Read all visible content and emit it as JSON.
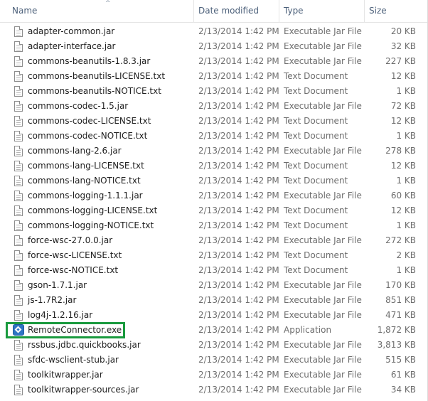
{
  "columns": {
    "name": "Name",
    "date": "Date modified",
    "type": "Type",
    "size": "Size"
  },
  "colors": {
    "highlight": "#1a9a3e",
    "header_text": "#4c607a",
    "app_icon": "#2f75c4"
  },
  "files": [
    {
      "name": "adapter-common.jar",
      "date": "2/13/2014 1:42 PM",
      "type": "Executable Jar File",
      "size": "20 KB",
      "icon": "file-icon"
    },
    {
      "name": "adapter-interface.jar",
      "date": "2/13/2014 1:42 PM",
      "type": "Executable Jar File",
      "size": "32 KB",
      "icon": "file-icon"
    },
    {
      "name": "commons-beanutils-1.8.3.jar",
      "date": "2/13/2014 1:42 PM",
      "type": "Executable Jar File",
      "size": "227 KB",
      "icon": "file-icon"
    },
    {
      "name": "commons-beanutils-LICENSE.txt",
      "date": "2/13/2014 1:42 PM",
      "type": "Text Document",
      "size": "12 KB",
      "icon": "file-icon"
    },
    {
      "name": "commons-beanutils-NOTICE.txt",
      "date": "2/13/2014 1:42 PM",
      "type": "Text Document",
      "size": "1 KB",
      "icon": "file-icon"
    },
    {
      "name": "commons-codec-1.5.jar",
      "date": "2/13/2014 1:42 PM",
      "type": "Executable Jar File",
      "size": "72 KB",
      "icon": "file-icon"
    },
    {
      "name": "commons-codec-LICENSE.txt",
      "date": "2/13/2014 1:42 PM",
      "type": "Text Document",
      "size": "12 KB",
      "icon": "file-icon"
    },
    {
      "name": "commons-codec-NOTICE.txt",
      "date": "2/13/2014 1:42 PM",
      "type": "Text Document",
      "size": "1 KB",
      "icon": "file-icon"
    },
    {
      "name": "commons-lang-2.6.jar",
      "date": "2/13/2014 1:42 PM",
      "type": "Executable Jar File",
      "size": "278 KB",
      "icon": "file-icon"
    },
    {
      "name": "commons-lang-LICENSE.txt",
      "date": "2/13/2014 1:42 PM",
      "type": "Text Document",
      "size": "12 KB",
      "icon": "file-icon"
    },
    {
      "name": "commons-lang-NOTICE.txt",
      "date": "2/13/2014 1:42 PM",
      "type": "Text Document",
      "size": "1 KB",
      "icon": "file-icon"
    },
    {
      "name": "commons-logging-1.1.1.jar",
      "date": "2/13/2014 1:42 PM",
      "type": "Executable Jar File",
      "size": "60 KB",
      "icon": "file-icon"
    },
    {
      "name": "commons-logging-LICENSE.txt",
      "date": "2/13/2014 1:42 PM",
      "type": "Text Document",
      "size": "12 KB",
      "icon": "file-icon"
    },
    {
      "name": "commons-logging-NOTICE.txt",
      "date": "2/13/2014 1:42 PM",
      "type": "Text Document",
      "size": "1 KB",
      "icon": "file-icon"
    },
    {
      "name": "force-wsc-27.0.0.jar",
      "date": "2/13/2014 1:42 PM",
      "type": "Executable Jar File",
      "size": "272 KB",
      "icon": "file-icon"
    },
    {
      "name": "force-wsc-LICENSE.txt",
      "date": "2/13/2014 1:42 PM",
      "type": "Text Document",
      "size": "2 KB",
      "icon": "file-icon"
    },
    {
      "name": "force-wsc-NOTICE.txt",
      "date": "2/13/2014 1:42 PM",
      "type": "Text Document",
      "size": "1 KB",
      "icon": "file-icon"
    },
    {
      "name": "gson-1.7.1.jar",
      "date": "2/13/2014 1:42 PM",
      "type": "Executable Jar File",
      "size": "170 KB",
      "icon": "file-icon"
    },
    {
      "name": "js-1.7R2.jar",
      "date": "2/13/2014 1:42 PM",
      "type": "Executable Jar File",
      "size": "851 KB",
      "icon": "file-icon"
    },
    {
      "name": "log4j-1.2.16.jar",
      "date": "2/13/2014 1:42 PM",
      "type": "Executable Jar File",
      "size": "471 KB",
      "icon": "file-icon"
    },
    {
      "name": "RemoteConnector.exe",
      "date": "2/13/2014 1:42 PM",
      "type": "Application",
      "size": "1,872 KB",
      "icon": "application-icon",
      "highlighted": true
    },
    {
      "name": "rssbus.jdbc.quickbooks.jar",
      "date": "2/13/2014 1:42 PM",
      "type": "Executable Jar File",
      "size": "3,813 KB",
      "icon": "file-icon"
    },
    {
      "name": "sfdc-wsclient-stub.jar",
      "date": "2/13/2014 1:42 PM",
      "type": "Executable Jar File",
      "size": "515 KB",
      "icon": "file-icon"
    },
    {
      "name": "toolkitwrapper.jar",
      "date": "2/13/2014 1:42 PM",
      "type": "Executable Jar File",
      "size": "61 KB",
      "icon": "file-icon"
    },
    {
      "name": "toolkitwrapper-sources.jar",
      "date": "2/13/2014 1:42 PM",
      "type": "Executable Jar File",
      "size": "34 KB",
      "icon": "file-icon"
    }
  ]
}
